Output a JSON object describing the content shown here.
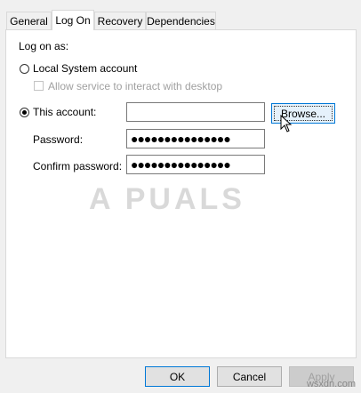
{
  "tabs": [
    {
      "label": "General"
    },
    {
      "label": "Log On"
    },
    {
      "label": "Recovery"
    },
    {
      "label": "Dependencies"
    }
  ],
  "logon": {
    "group_label": "Log on as:",
    "local_system_label": "Local System account",
    "allow_interact_label": "Allow service to interact with desktop",
    "this_account_label": "This account:",
    "account_value": "",
    "browse_label": "Browse...",
    "password_label": "Password:",
    "password_value": "●●●●●●●●●●●●●●●",
    "confirm_label": "Confirm password:",
    "confirm_value": "●●●●●●●●●●●●●●●"
  },
  "buttons": {
    "ok": "OK",
    "cancel": "Cancel",
    "apply": "Apply"
  },
  "watermark": "A  PUALS",
  "site": "wsxdn.com"
}
